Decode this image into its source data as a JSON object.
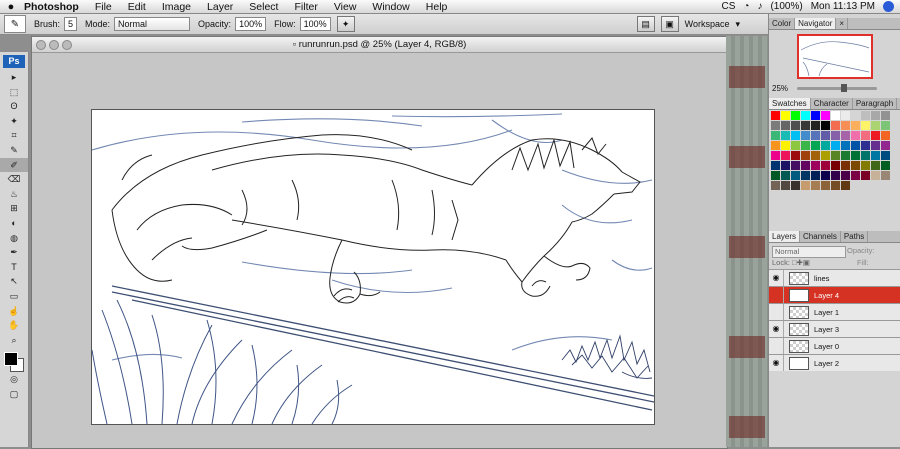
{
  "menubar": {
    "apple": "",
    "app_name": "Photoshop",
    "items": [
      "File",
      "Edit",
      "Image",
      "Layer",
      "Select",
      "Filter",
      "View",
      "Window",
      "Help"
    ],
    "status": {
      "cs": "CS",
      "battery": "(100%)",
      "clock": "Mon 11:13 PM"
    }
  },
  "options": {
    "brush_label": "Brush:",
    "brush_size": "5",
    "mode_label": "Mode:",
    "mode_value": "Normal",
    "opacity_label": "Opacity:",
    "opacity_value": "100%",
    "flow_label": "Flow:",
    "flow_value": "100%",
    "workspace_label": "Workspace"
  },
  "toolbox": {
    "logo": "Ps",
    "tools": [
      "▸",
      "⬚",
      "ʘ",
      "✦",
      "⌗",
      "✎",
      "✐",
      "⌫",
      "♨",
      "⊞",
      "◐",
      "◍",
      "✒",
      "T",
      "↖",
      "▭",
      "☝",
      "✋",
      "⌕"
    ],
    "active_index": 6,
    "foreground_color": "#000000",
    "background_color": "#ffffff"
  },
  "document": {
    "title": "runrunrun.psd @ 25% (Layer 4, RGB/8)"
  },
  "navigator": {
    "tabs": [
      "Color",
      "Navigator"
    ],
    "active_tab": 1,
    "zoom": "25%"
  },
  "swatches": {
    "tabs": [
      "Swatches",
      "Character",
      "Paragraph"
    ],
    "rows": [
      [
        "#ff0000",
        "#ffff00",
        "#00ff00",
        "#00ffff",
        "#0000ff",
        "#ff00ff",
        "#ffffff",
        "#ebebeb",
        "#d5d5d5",
        "#bebebe",
        "#a8a8a8",
        "#929292"
      ],
      [
        "#7b7b7b",
        "#656565",
        "#4f4f4f",
        "#383838",
        "#222222",
        "#000000",
        "#f26c4f",
        "#f68e55",
        "#fbaf5c",
        "#fff467",
        "#acd372",
        "#7cc576"
      ],
      [
        "#3bb878",
        "#1abbb4",
        "#00bff3",
        "#438ccb",
        "#5574b9",
        "#605ca8",
        "#855fa8",
        "#a763a8",
        "#f06ea9",
        "#f26d7d",
        "#ed1c24",
        "#f26522"
      ],
      [
        "#f7941d",
        "#fff200",
        "#8dc63f",
        "#39b54a",
        "#00a651",
        "#00a99d",
        "#00aeef",
        "#0072bc",
        "#0054a6",
        "#2e3192",
        "#662d91",
        "#92278f"
      ],
      [
        "#ec008c",
        "#ed145b",
        "#9e0b0f",
        "#a0410d",
        "#a36209",
        "#aba000",
        "#598527",
        "#1a7b30",
        "#007236",
        "#00746b",
        "#0076a3",
        "#004b80"
      ],
      [
        "#003471",
        "#1b1464",
        "#440e62",
        "#630460",
        "#9e005d",
        "#9e0039",
        "#790000",
        "#7b2e00",
        "#7d4900",
        "#827b00",
        "#406618",
        "#005e20"
      ],
      [
        "#005826",
        "#005952",
        "#005b7f",
        "#003663",
        "#002157",
        "#0d004c",
        "#32004b",
        "#4b0049",
        "#7b0046",
        "#7a0026",
        "#c7b299",
        "#998675"
      ],
      [
        "#736357",
        "#534741",
        "#37302d",
        "#c69c6e",
        "#a67c52",
        "#8c6239",
        "#754c24",
        "#603913"
      ]
    ]
  },
  "layers": {
    "tabs": [
      "Layers",
      "Channels",
      "Paths"
    ],
    "blend": "Normal",
    "opacity_label": "Opacity:",
    "lock_label": "Lock:",
    "fill_label": "Fill:",
    "items": [
      {
        "name": "lines",
        "visible": true,
        "active": false
      },
      {
        "name": "Layer 4",
        "visible": false,
        "active": true
      },
      {
        "name": "Layer 1",
        "visible": false,
        "active": false
      },
      {
        "name": "Layer 3",
        "visible": true,
        "active": false
      },
      {
        "name": "Layer 0",
        "visible": false,
        "active": false
      },
      {
        "name": "Layer 2",
        "visible": true,
        "active": false
      }
    ]
  }
}
